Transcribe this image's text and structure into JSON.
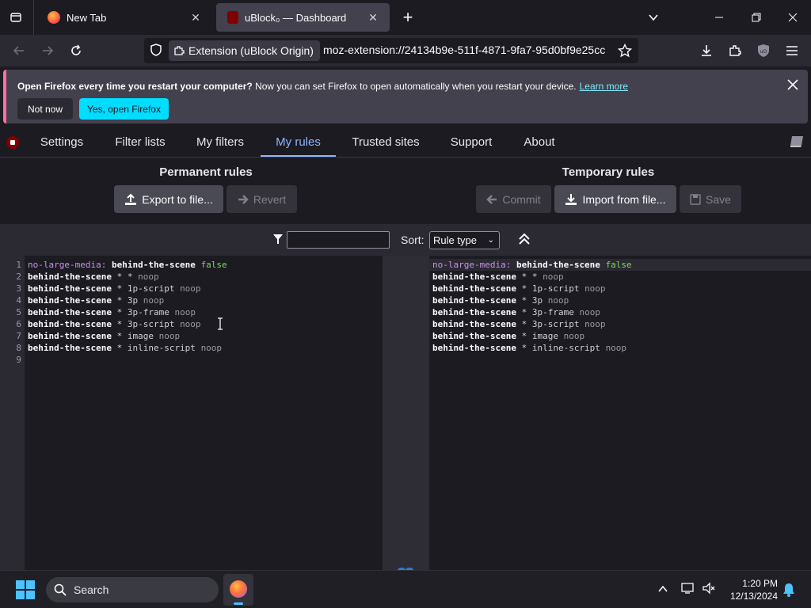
{
  "browser": {
    "tabs": [
      {
        "title": "New Tab",
        "active": false
      },
      {
        "title": "uBlock₀ — Dashboard",
        "active": true
      }
    ],
    "identity_label": "Extension (uBlock Origin)",
    "url": "moz-extension://24134b9e-511f-4871-9fa7-95d0bf9e25cc"
  },
  "notification": {
    "bold": "Open Firefox every time you restart your computer?",
    "text": " Now you can set Firefox to open automatically when you restart your device.",
    "link": "Learn more",
    "not_now": "Not now",
    "yes": "Yes, open Firefox"
  },
  "dashboard": {
    "tabs": [
      "Settings",
      "Filter lists",
      "My filters",
      "My rules",
      "Trusted sites",
      "Support",
      "About"
    ],
    "active_tab": "My rules"
  },
  "rules": {
    "permanent_title": "Permanent rules",
    "temporary_title": "Temporary rules",
    "export": "Export to file...",
    "revert": "Revert",
    "commit": "Commit",
    "import": "Import from file...",
    "save": "Save",
    "sort_label": "Sort:",
    "sort_value": "Rule type",
    "line_numbers": [
      "1",
      "2",
      "3",
      "4",
      "5",
      "6",
      "7",
      "8",
      "9"
    ],
    "permanent": [
      {
        "kw": "no-large-media:",
        "host": "behind-the-scene",
        "mid": "",
        "action": "false"
      },
      {
        "kw": "",
        "host": "behind-the-scene",
        "mid": " * * ",
        "action": "noop"
      },
      {
        "kw": "",
        "host": "behind-the-scene",
        "mid": " * 1p-script ",
        "action": "noop"
      },
      {
        "kw": "",
        "host": "behind-the-scene",
        "mid": " * 3p ",
        "action": "noop"
      },
      {
        "kw": "",
        "host": "behind-the-scene",
        "mid": " * 3p-frame ",
        "action": "noop"
      },
      {
        "kw": "",
        "host": "behind-the-scene",
        "mid": " * 3p-script ",
        "action": "noop"
      },
      {
        "kw": "",
        "host": "behind-the-scene",
        "mid": " * image ",
        "action": "noop"
      },
      {
        "kw": "",
        "host": "behind-the-scene",
        "mid": " * inline-script ",
        "action": "noop"
      }
    ],
    "temporary": [
      {
        "kw": "no-large-media:",
        "host": "behind-the-scene",
        "mid": "",
        "action": "false"
      },
      {
        "kw": "",
        "host": "behind-the-scene",
        "mid": " * * ",
        "action": "noop"
      },
      {
        "kw": "",
        "host": "behind-the-scene",
        "mid": " * 1p-script ",
        "action": "noop"
      },
      {
        "kw": "",
        "host": "behind-the-scene",
        "mid": " * 3p ",
        "action": "noop"
      },
      {
        "kw": "",
        "host": "behind-the-scene",
        "mid": " * 3p-frame ",
        "action": "noop"
      },
      {
        "kw": "",
        "host": "behind-the-scene",
        "mid": " * 3p-script ",
        "action": "noop"
      },
      {
        "kw": "",
        "host": "behind-the-scene",
        "mid": " * image ",
        "action": "noop"
      },
      {
        "kw": "",
        "host": "behind-the-scene",
        "mid": " * inline-script ",
        "action": "noop"
      }
    ]
  },
  "taskbar": {
    "search_placeholder": "Search",
    "time": "1:20 PM",
    "date": "12/13/2024"
  },
  "colors": {
    "accent": "#8cb4ff",
    "notif_primary": "#00ddff",
    "false_green": "#7ddc5a",
    "keyword_purple": "#c792ea"
  }
}
